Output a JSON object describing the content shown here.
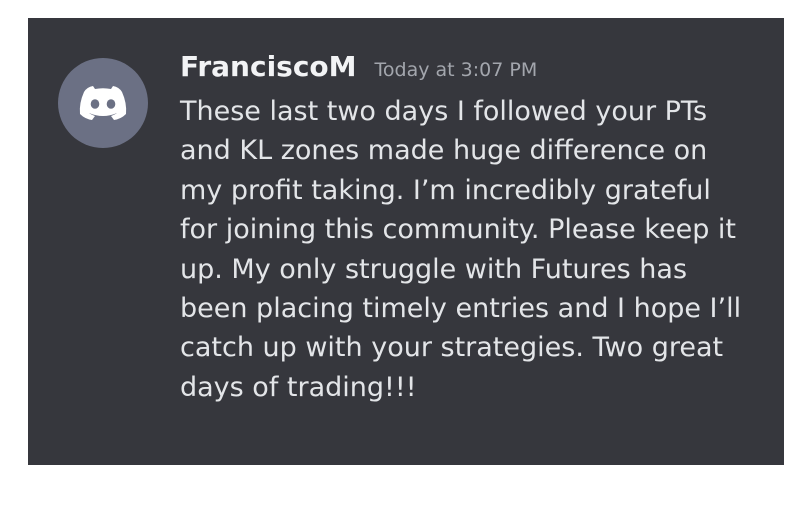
{
  "message": {
    "author": "FranciscoM",
    "timestamp": "Today at 3:07 PM",
    "avatar_icon": "discord-icon",
    "lines": [
      "These last two days I followed your PTs",
      "and KL zones made huge difference on",
      "my profit taking. I’m incredibly grateful",
      "for joining this community. Please keep it",
      "up. My only struggle with Futures has",
      "been placing timely entries and I hope I’ll",
      "catch up with your strategies. Two great",
      "days of trading!!!"
    ]
  },
  "colors": {
    "background": "#36373d",
    "avatar": "#6b7084",
    "author": "#f2f3f5",
    "timestamp": "#a3a6ad",
    "text": "#e3e5e8"
  }
}
